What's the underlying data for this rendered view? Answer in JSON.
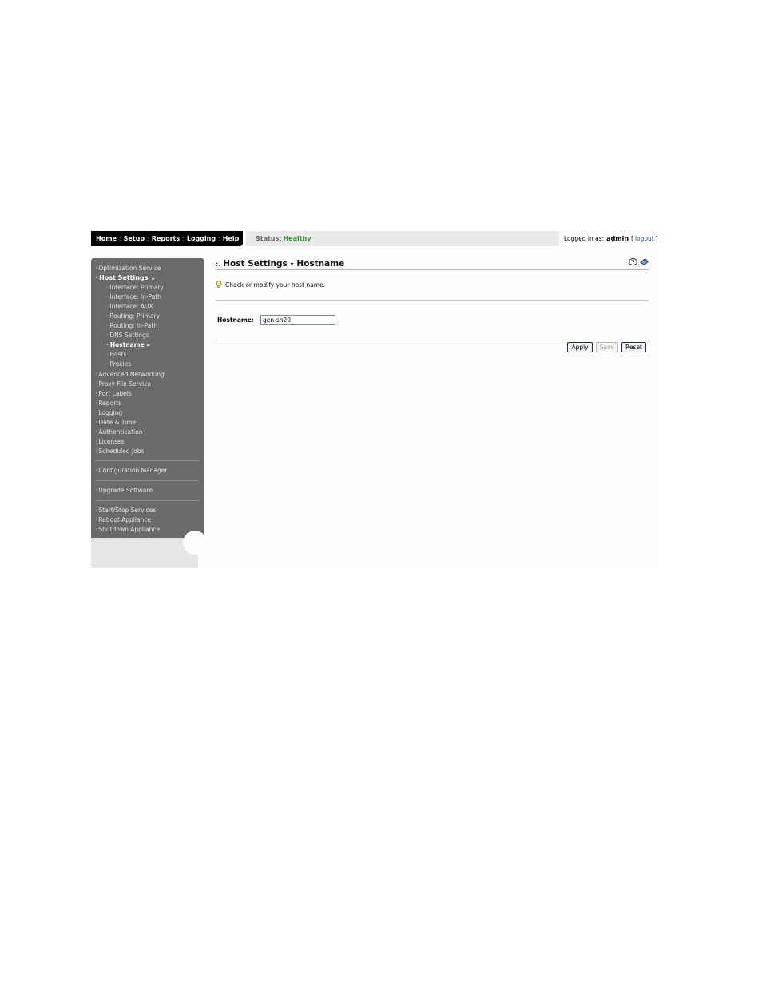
{
  "nav": {
    "items": [
      {
        "label": "Home"
      },
      {
        "label": "Setup",
        "active": true
      },
      {
        "label": "Reports"
      },
      {
        "label": "Logging"
      },
      {
        "label": "Help"
      }
    ]
  },
  "status": {
    "label": "Status:",
    "value": "Healthy",
    "color": "#2a9a2a"
  },
  "login": {
    "prefix": "Logged in as:",
    "user": "admin",
    "open_bracket": "[",
    "logout": "logout",
    "close_bracket": "]"
  },
  "sidebar": {
    "groups": [
      [
        {
          "label": "Optimization Service"
        },
        {
          "label": "Host Settings ↓",
          "open": true
        },
        {
          "label": "Interface: Primary",
          "sub": true
        },
        {
          "label": "Interface: In-Path",
          "sub": true
        },
        {
          "label": "Interface: AUX",
          "sub": true
        },
        {
          "label": "Routing: Primary",
          "sub": true
        },
        {
          "label": "Routing: In-Path",
          "sub": true
        },
        {
          "label": "DNS Settings",
          "sub": true
        },
        {
          "label": "Hostname »",
          "sub": true,
          "current": true
        },
        {
          "label": "Hosts",
          "sub": true
        },
        {
          "label": "Proxies",
          "sub": true
        },
        {
          "label": "Advanced Networking"
        },
        {
          "label": "Proxy File Service"
        },
        {
          "label": "Port Labels"
        },
        {
          "label": "Reports"
        },
        {
          "label": "Logging"
        },
        {
          "label": "Date & Time"
        },
        {
          "label": "Authentication"
        },
        {
          "label": "Licenses"
        },
        {
          "label": "Scheduled Jobs"
        }
      ],
      [
        {
          "label": "Configuration Manager"
        }
      ],
      [
        {
          "label": "Upgrade Software"
        }
      ],
      [
        {
          "label": "Start/Stop Services"
        },
        {
          "label": "Reboot Appliance"
        },
        {
          "label": "Shutdown Appliance"
        }
      ]
    ]
  },
  "main": {
    "title": "Host Settings - Hostname",
    "tip": "Check or modify your host name.",
    "hostname_label": "Hostname:",
    "hostname_value": "gen-sh20",
    "buttons": {
      "apply": "Apply",
      "save": "Save",
      "reset": "Reset"
    }
  }
}
